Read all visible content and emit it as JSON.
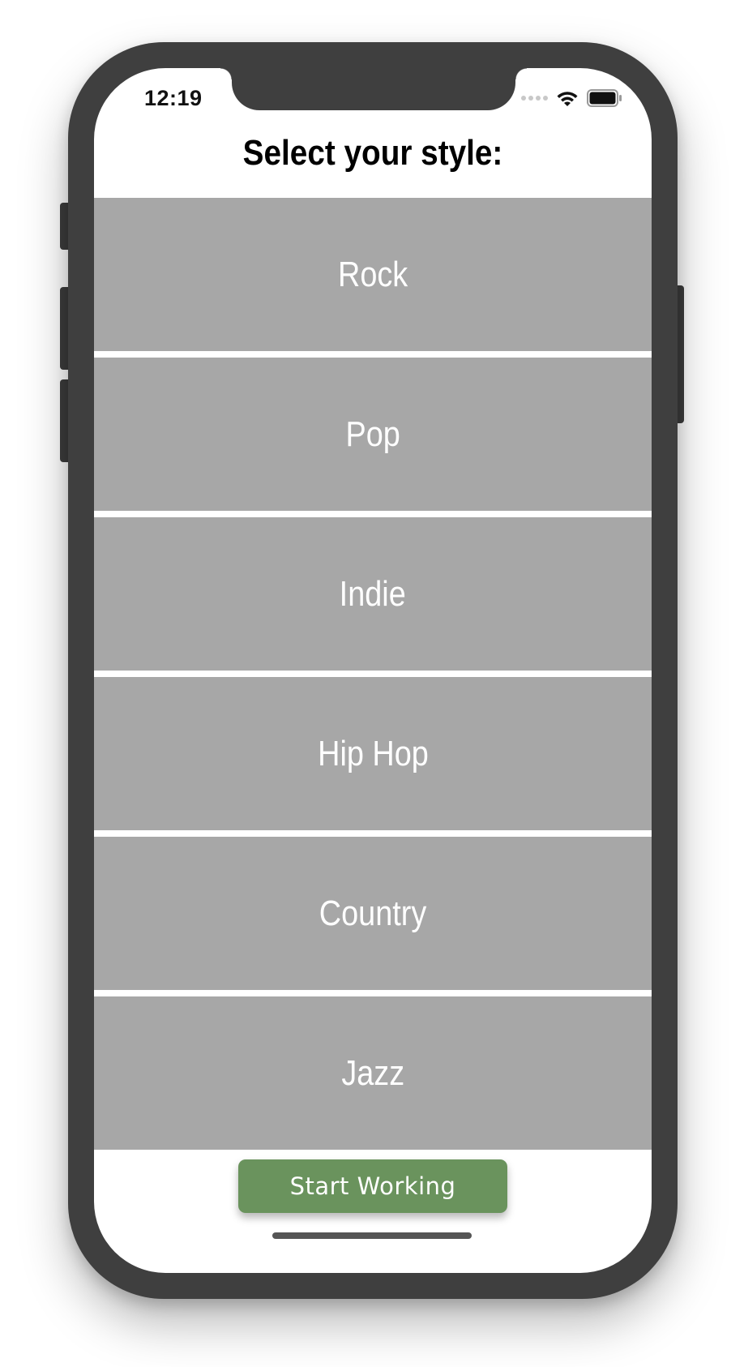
{
  "status_bar": {
    "time": "12:19",
    "wifi_icon": "wifi-icon",
    "battery_icon": "battery-icon"
  },
  "title": "Select your style:",
  "styles": [
    {
      "label": "Rock"
    },
    {
      "label": "Pop"
    },
    {
      "label": "Indie"
    },
    {
      "label": "Hip Hop"
    },
    {
      "label": "Country"
    },
    {
      "label": "Jazz"
    }
  ],
  "start_button": {
    "label": "Start Working"
  },
  "colors": {
    "frame": "#3f3f3f",
    "item_background": "#a7a7a7",
    "button": "#6a935d"
  }
}
